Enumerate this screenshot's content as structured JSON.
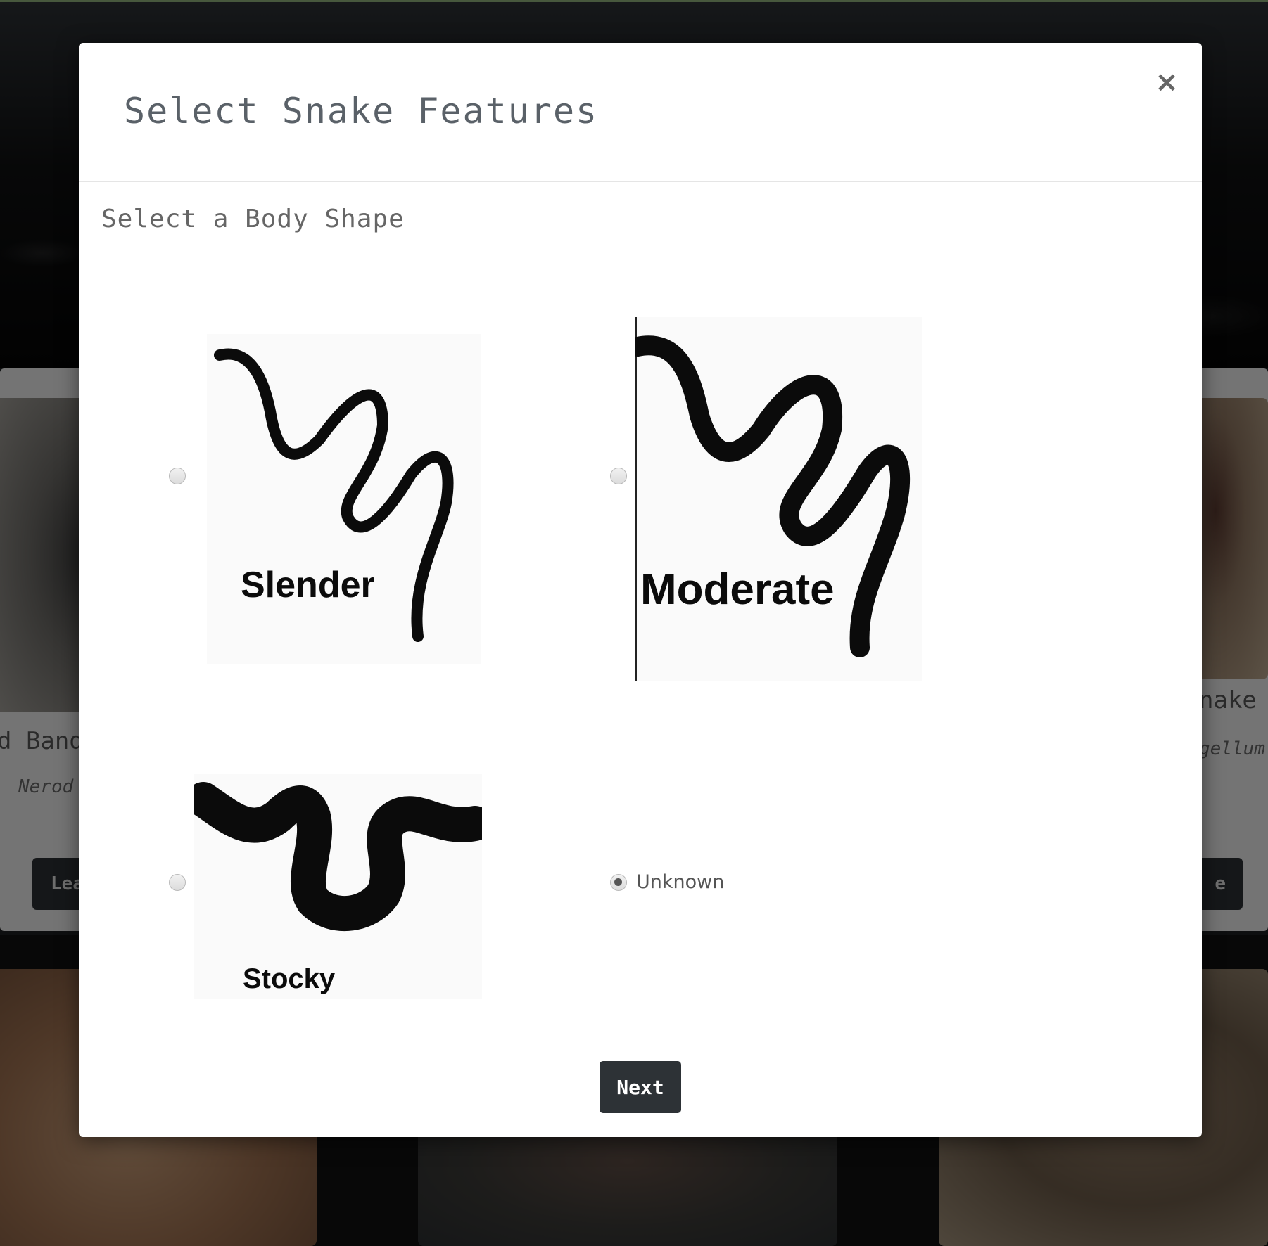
{
  "theme": {
    "accent": "#8fb07a",
    "modal_bg": "#ffffff",
    "button_bg": "#2d3236"
  },
  "background": {
    "left_card": {
      "name_fragment": "d Band",
      "scientific_fragment": "Nerod",
      "button_fragment": "Lea"
    },
    "right_card": {
      "name_fragment": "nake",
      "scientific_fragment": "gellum",
      "button_fragment": "e"
    }
  },
  "modal": {
    "title": "Select Snake Features",
    "close_label": "×",
    "section_label": "Select a Body Shape",
    "options": [
      {
        "id": "slender",
        "label": "Slender",
        "icon": "slender-snake-icon",
        "selected": false
      },
      {
        "id": "moderate",
        "label": "Moderate",
        "icon": "moderate-snake-icon",
        "selected": false
      },
      {
        "id": "stocky",
        "label": "Stocky",
        "icon": "stocky-snake-icon",
        "selected": false
      },
      {
        "id": "unknown",
        "label": "Unknown",
        "selected": true
      }
    ],
    "next_label": "Next"
  }
}
